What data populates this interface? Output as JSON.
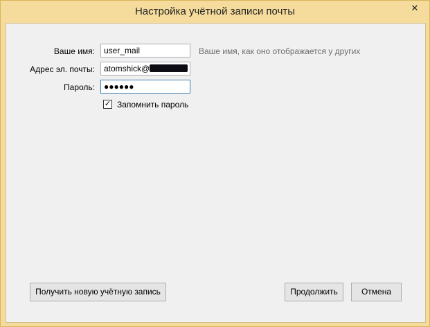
{
  "window": {
    "title": "Настройка учётной записи почты",
    "close_glyph": "✕"
  },
  "form": {
    "name_label": "Ваше имя:",
    "name_value": "user_mail",
    "name_hint": "Ваше имя, как оно отображается у других",
    "email_label": "Адрес эл. почты:",
    "email_value": "atomshick@",
    "email_redacted": true,
    "password_label": "Пароль:",
    "password_mask": "●●●●●●",
    "remember_label": "Запомнить пароль",
    "remember_checked": true
  },
  "buttons": {
    "new_account": "Получить новую учётную запись",
    "continue": "Продолжить",
    "cancel": "Отмена"
  }
}
